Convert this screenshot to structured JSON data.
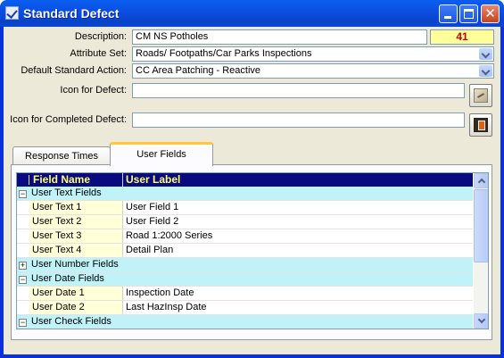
{
  "window": {
    "title": "Standard Defect",
    "icon": "checkmark-icon",
    "controls": [
      "minimize-icon",
      "maximize-icon",
      "close-icon"
    ]
  },
  "form": {
    "description_label": "Description:",
    "description_value": "CM NS Potholes",
    "count": "41",
    "attribute_set_label": "Attribute Set:",
    "attribute_set_value": "Roads/ Footpaths/Car Parks Inspections",
    "default_action_label": "Default Standard Action:",
    "default_action_value": "CC Area Patching - Reactive",
    "icon_defect_label": "Icon for Defect:",
    "icon_defect_value": "",
    "icon_completed_label": "Icon for Completed Defect:",
    "icon_completed_value": ""
  },
  "tabs": [
    {
      "label": "Response Times",
      "active": false
    },
    {
      "label": "User Fields",
      "active": true
    }
  ],
  "grid": {
    "columns": [
      "Field Name",
      "User Label"
    ],
    "rows": [
      {
        "type": "group",
        "expander": "−",
        "label": "User Text Fields"
      },
      {
        "type": "item",
        "field": "User Text 1",
        "value": "User Field 1"
      },
      {
        "type": "item",
        "field": "User Text 2",
        "value": "User Field 2"
      },
      {
        "type": "item",
        "field": "User Text 3",
        "value": "Road 1:2000 Series"
      },
      {
        "type": "item",
        "field": "User Text 4",
        "value": "Detail Plan"
      },
      {
        "type": "group",
        "expander": "+",
        "label": "User Number Fields"
      },
      {
        "type": "group",
        "expander": "−",
        "label": "User Date Fields"
      },
      {
        "type": "item",
        "field": "User Date 1",
        "value": "Inspection Date"
      },
      {
        "type": "item",
        "field": "User Date 2",
        "value": "Last HazInsp Date"
      },
      {
        "type": "group",
        "expander": "−",
        "label": "User Check Fields"
      }
    ]
  },
  "colors": {
    "title_bar": "#0a5ff0",
    "grid_header_bg": "#0a0a80",
    "grid_header_text": "#ffff66",
    "group_row_bg": "#bff3f8",
    "field_cell_bg": "#ffffd8",
    "count_bg": "#ffff99",
    "count_text": "#c80000",
    "active_tab_accent": "#ffc83c"
  }
}
